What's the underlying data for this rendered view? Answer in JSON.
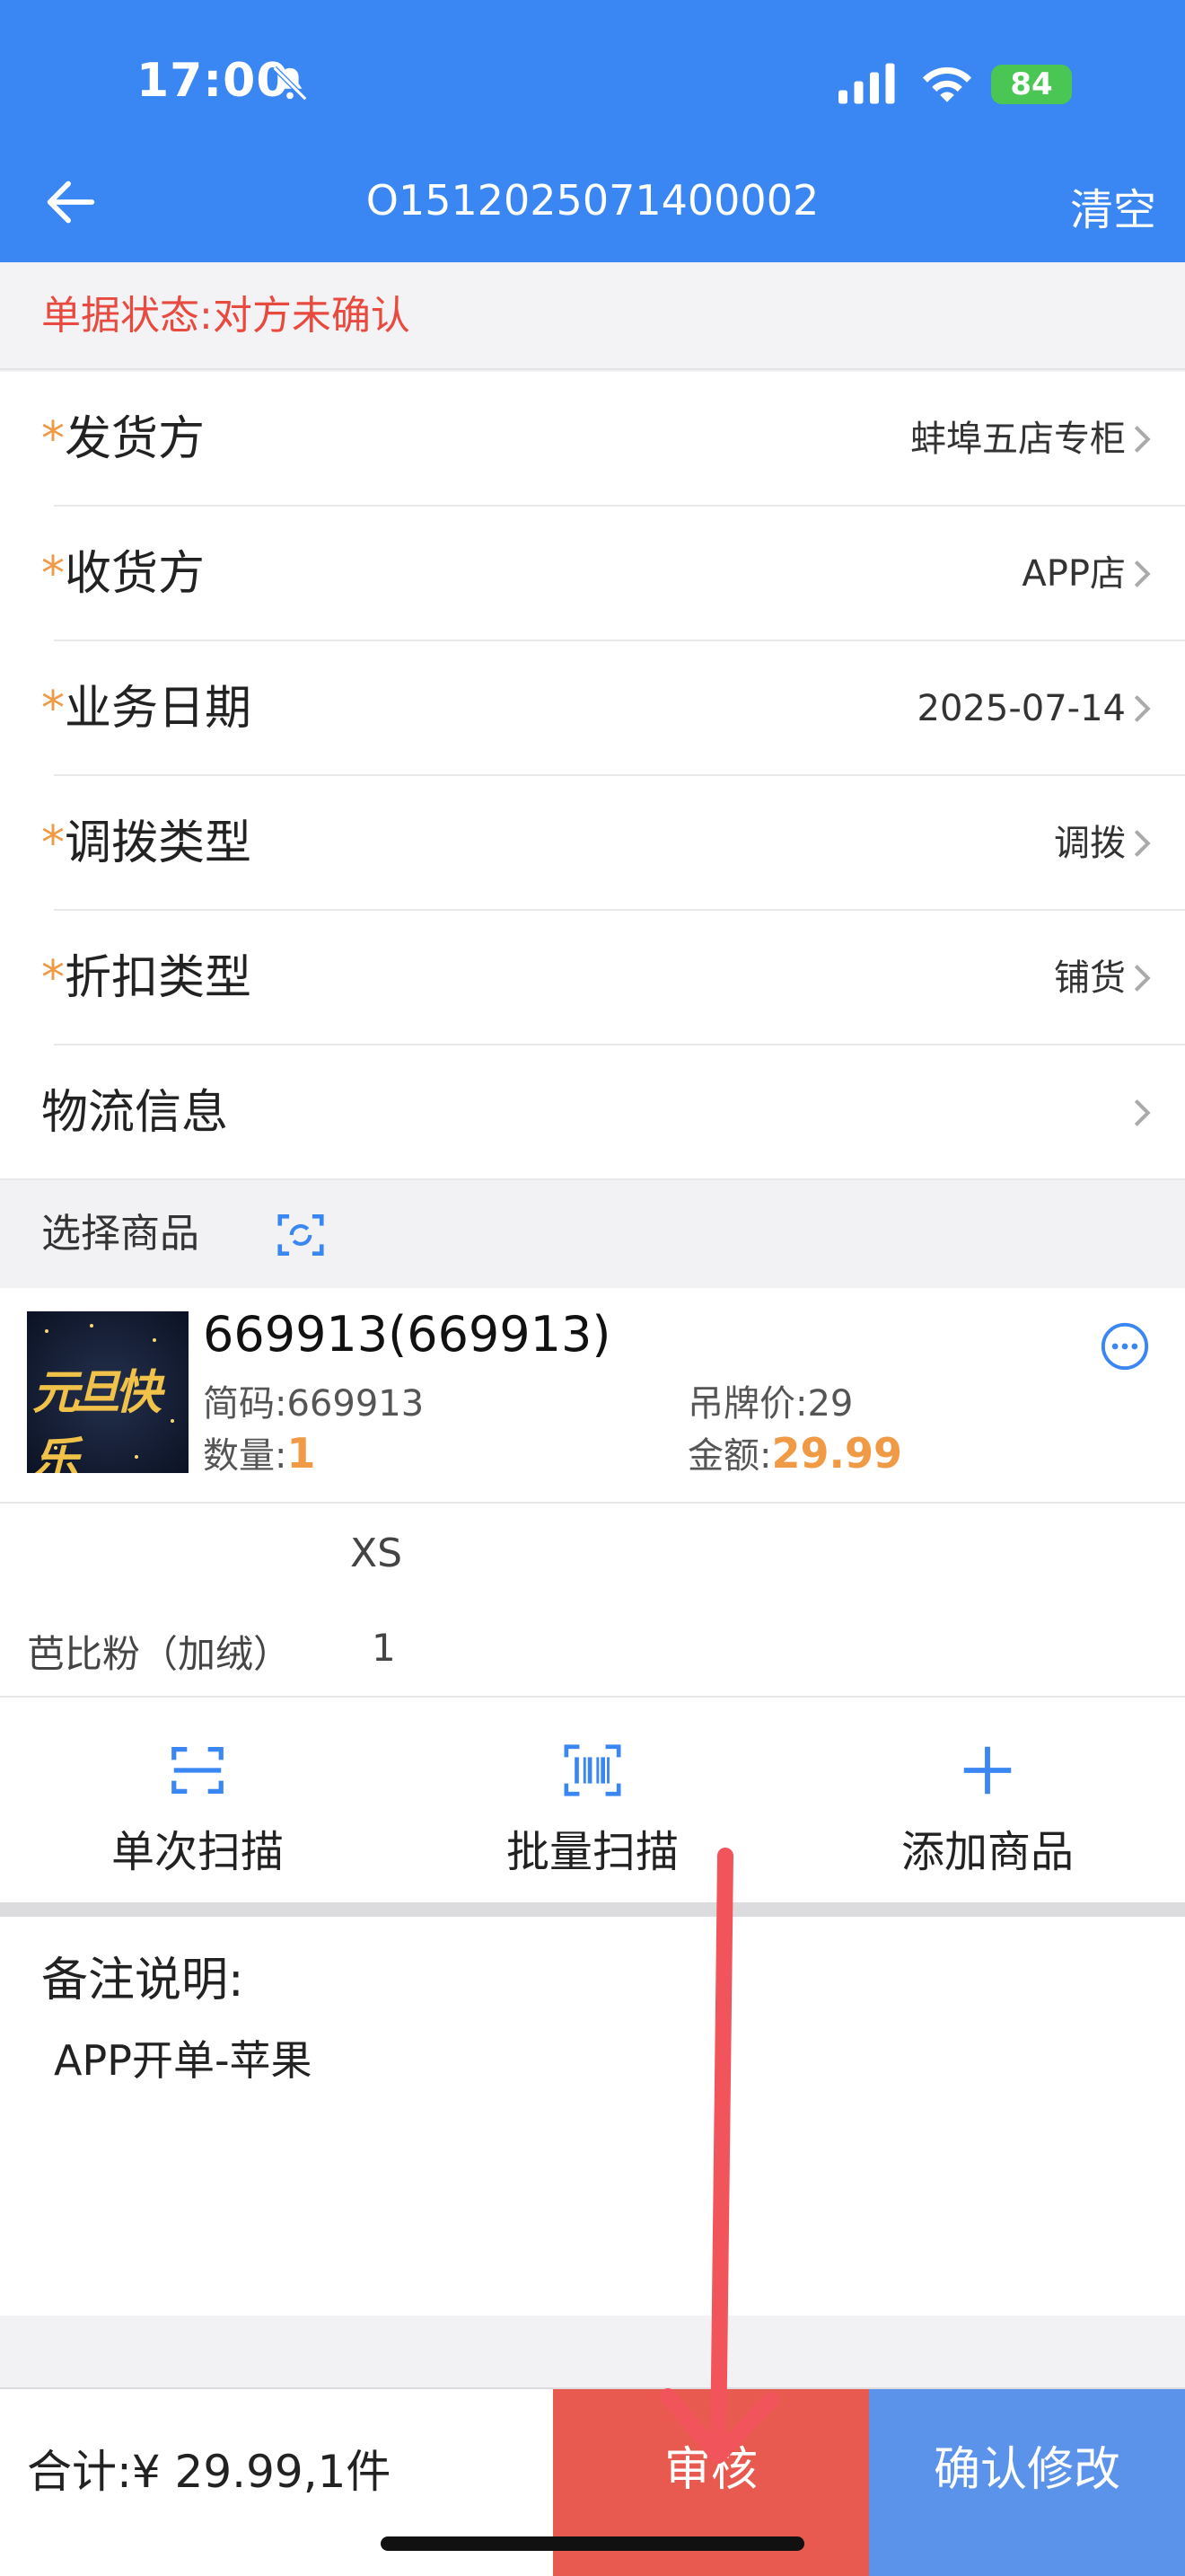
{
  "status_bar": {
    "time": "17:00",
    "battery": "84"
  },
  "header": {
    "title": "O1512025071400002",
    "clear_label": "清空"
  },
  "doc_status": "单据状态:对方未确认",
  "form": {
    "rows": [
      {
        "label": "发货方",
        "required": "*",
        "value": "蚌埠五店专柜"
      },
      {
        "label": "收货方",
        "required": "*",
        "value": "APP店"
      },
      {
        "label": "业务日期",
        "required": "*",
        "value": "2025-07-14"
      },
      {
        "label": "调拨类型",
        "required": "*",
        "value": "调拨"
      },
      {
        "label": "折扣类型",
        "required": "*",
        "value": "铺货"
      },
      {
        "label": "物流信息",
        "required": "",
        "value": ""
      }
    ]
  },
  "select_products": {
    "label": "选择商品"
  },
  "product": {
    "name": "669913(669913)",
    "code_label": "简码:",
    "code": "669913",
    "tag_price_label": "吊牌价:",
    "tag_price": "29",
    "qty_label": "数量:",
    "qty": "1",
    "amount_label": "金额:",
    "amount": "29.99",
    "thumb_text": "元旦快乐"
  },
  "size_grid": {
    "size": "XS",
    "color": "芭比粉（加绒）",
    "qty": "1"
  },
  "actions": [
    {
      "label": "单次扫描",
      "icon": "scan-frame-icon"
    },
    {
      "label": "批量扫描",
      "icon": "barcode-icon"
    },
    {
      "label": "添加商品",
      "icon": "plus-icon"
    }
  ],
  "remarks": {
    "title": "备注说明:",
    "text": "APP开单-苹果"
  },
  "footer": {
    "total": "合计:¥ 29.99,1件",
    "audit_label": "审核",
    "confirm_label": "确认修改"
  },
  "colors": {
    "primary": "#3a86f2",
    "audit": "#e85a4f",
    "confirm": "#5b93ea",
    "status_red": "#e84a3f",
    "accent_orange": "#f09a45"
  }
}
